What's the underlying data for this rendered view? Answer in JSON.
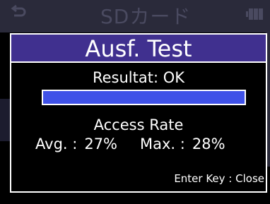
{
  "background": {
    "title": "SDカード",
    "back_icon": "back-arrow-icon",
    "battery_icon": "battery-icon"
  },
  "dialog": {
    "title": "Ausf. Test",
    "result": "Resultat: OK",
    "progress": 1.0,
    "access_rate_label": "Access Rate",
    "avg_label": "Avg. :",
    "avg_value": "27%",
    "max_label": "Max. :",
    "max_value": "28%",
    "footer_hint": "Enter Key : Close"
  },
  "colors": {
    "title_bar": "#40308f",
    "progress_fill": "#3f51e8",
    "text": "#ffffff",
    "background": "#000000"
  }
}
